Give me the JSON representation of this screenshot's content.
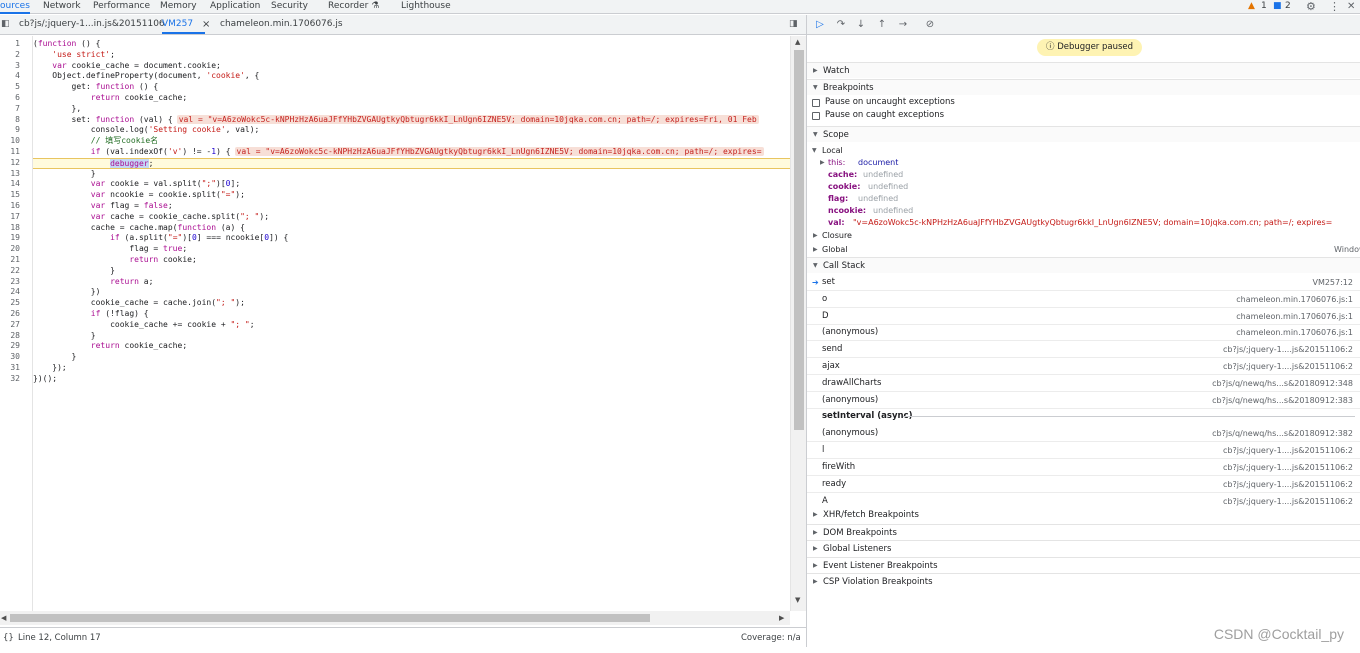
{
  "top_tabs": [
    {
      "label": "ources",
      "active": true
    },
    {
      "label": "Network"
    },
    {
      "label": "Performance"
    },
    {
      "label": "Memory"
    },
    {
      "label": "Application"
    },
    {
      "label": "Security"
    },
    {
      "label": "Recorder ⚗"
    },
    {
      "label": "Lighthouse"
    }
  ],
  "status": {
    "warnings": "1",
    "messages": "2"
  },
  "editor_tabs": [
    {
      "label": "cb?js/;jquery-1...in.js&20151106"
    },
    {
      "label": "VM257",
      "active": true,
      "close": "×"
    },
    {
      "label": "chameleon.min.1706076.js"
    }
  ],
  "code_lines": [
    "(function () {",
    "    'use strict';",
    "    var cookie_cache = document.cookie;",
    "    Object.defineProperty(document, 'cookie', {",
    "        get: function () {",
    "            return cookie_cache;",
    "        },",
    "        set: function (val) {",
    "            console.log('Setting cookie', val);",
    "            // 填写cookie名",
    "            if (val.indexOf('v') != -1) {",
    "                debugger;",
    "            }",
    "            var cookie = val.split(\";\")[0];",
    "            var ncookie = cookie.split(\"=\");",
    "            var flag = false;",
    "            var cache = cookie_cache.split(\"; \");",
    "            cache = cache.map(function (a) {",
    "                if (a.split(\"=\")[0] === ncookie[0]) {",
    "                    flag = true;",
    "                    return cookie;",
    "                }",
    "                return a;",
    "            })",
    "            cookie_cache = cache.join(\"; \");",
    "            if (!flag) {",
    "                cookie_cache += cookie + \"; \";",
    "            }",
    "            return cookie_cache;",
    "        }",
    "    });",
    "})();"
  ],
  "inline_value_line8": "val = \"v=A6zoWokc5c-kNPHzHzA6uaJFfYHbZVGAUgtkyQbtugr6kkI_LnUgn6IZNE5V; domain=10jqka.com.cn; path=/; expires=Fri, 01 Feb",
  "inline_value_line11": "val = \"v=A6zoWokc5c-kNPHzHzA6uaJFfYHbZVGAUgtkyQbtugr6kkI_LnUgn6IZNE5V; domain=10jqka.com.cn; path=/; expires=",
  "paused_line": 12,
  "footer": {
    "position": "Line 12, Column 17",
    "coverage": "Coverage: n/a"
  },
  "paused_banner": "Debugger paused",
  "sections": {
    "watch": "Watch",
    "breakpoints": "Breakpoints",
    "pause_uncaught": "Pause on uncaught exceptions",
    "pause_caught": "Pause on caught exceptions",
    "scope": "Scope",
    "local": "Local",
    "closure": "Closure",
    "global": "Global",
    "global_value": "Window",
    "call_stack": "Call Stack",
    "xhr": "XHR/fetch Breakpoints",
    "dom": "DOM Breakpoints",
    "global_listeners": "Global Listeners",
    "event_listener": "Event Listener Breakpoints",
    "csp": "CSP Violation Breakpoints"
  },
  "scope_vars": [
    {
      "key": "this",
      "value": "document",
      "kind": "obj"
    },
    {
      "key": "cache",
      "value": "undefined",
      "kind": "undef"
    },
    {
      "key": "cookie",
      "value": "undefined",
      "kind": "undef"
    },
    {
      "key": "flag",
      "value": "undefined",
      "kind": "undef"
    },
    {
      "key": "ncookie",
      "value": "undefined",
      "kind": "undef"
    },
    {
      "key": "val",
      "value": "\"v=A6zoWokc5c-kNPHzHzA6uaJFfYHbZVGAUgtkyQbtugr6kkI_LnUgn6IZNE5V; domain=10jqka.com.cn; path=/; expires=",
      "kind": "str"
    }
  ],
  "call_stack": [
    {
      "fn": "set",
      "loc": "VM257:12",
      "current": true
    },
    {
      "fn": "o",
      "loc": "chameleon.min.1706076.js:1"
    },
    {
      "fn": "D",
      "loc": "chameleon.min.1706076.js:1"
    },
    {
      "fn": "(anonymous)",
      "loc": "chameleon.min.1706076.js:1"
    },
    {
      "fn": "send",
      "loc": "cb?js/;jquery-1....js&20151106:2"
    },
    {
      "fn": "ajax",
      "loc": "cb?js/;jquery-1....js&20151106:2"
    },
    {
      "fn": "drawAllCharts",
      "loc": "cb?js/q/newq/hs...s&20180912:348"
    },
    {
      "fn": "(anonymous)",
      "loc": "cb?js/q/newq/hs...s&20180912:383"
    }
  ],
  "async_label": "setInterval (async)",
  "call_stack_async": [
    {
      "fn": "(anonymous)",
      "loc": "cb?js/q/newq/hs...s&20180912:382"
    },
    {
      "fn": "l",
      "loc": "cb?js/;jquery-1....js&20151106:2"
    },
    {
      "fn": "fireWith",
      "loc": "cb?js/;jquery-1....js&20151106:2"
    },
    {
      "fn": "ready",
      "loc": "cb?js/;jquery-1....js&20151106:2"
    },
    {
      "fn": "A",
      "loc": "cb?js/;jquery-1....js&20151106:2"
    }
  ],
  "watermark": "CSDN @Cocktail_py"
}
